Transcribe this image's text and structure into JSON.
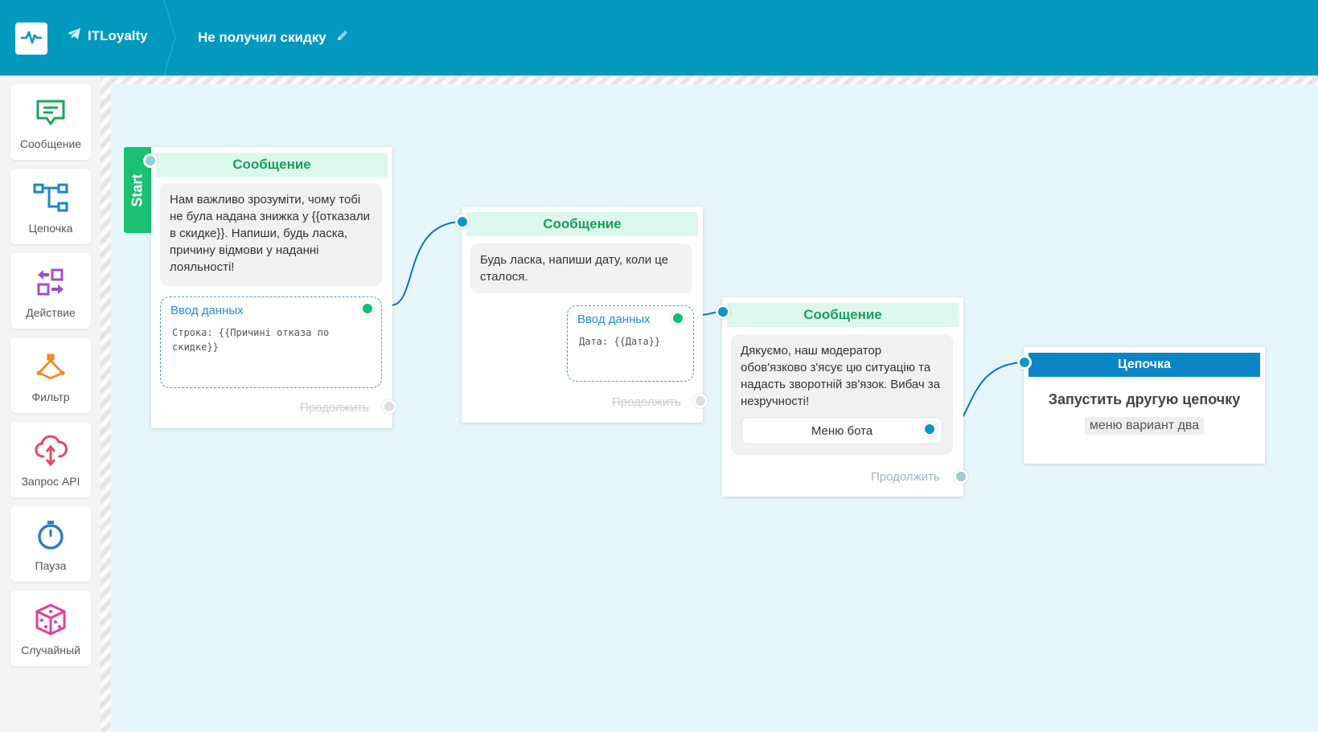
{
  "header": {
    "bot_name": "ITLoyalty",
    "chain_title": "Не получил скидку",
    "icons": {
      "logo": "pulse-icon",
      "bot": "telegram-icon",
      "edit": "pencil-icon"
    }
  },
  "sidebar": {
    "items": [
      {
        "label": "Сообщение",
        "icon": "message-icon",
        "color": "#1aa85a"
      },
      {
        "label": "Цепочка",
        "icon": "chain-icon",
        "color": "#1487c8"
      },
      {
        "label": "Действие",
        "icon": "action-icon",
        "color": "#a04fc9"
      },
      {
        "label": "Фильтр",
        "icon": "filter-icon",
        "color": "#f08a1c"
      },
      {
        "label": "Запрос API",
        "icon": "api-cloud-icon",
        "color": "#e14b66"
      },
      {
        "label": "Пауза",
        "icon": "timer-icon",
        "color": "#2f7fb8"
      },
      {
        "label": "Случайный",
        "icon": "dice-icon",
        "color": "#e0409a"
      }
    ]
  },
  "nodes": {
    "start_label": "Start",
    "node1": {
      "title": "Сообщение",
      "text": "Нам важливо зрозуміти, чому тобі не була надана знижка у {{отказали в  скидке}}. Напиши, будь ласка, причину відмови у наданні лояльності!",
      "input_title": "Ввод данных",
      "input_value": "Строка: {{Причині отказа по скидке}}",
      "continue": "Продолжить"
    },
    "node2": {
      "title": "Сообщение",
      "text": "Будь ласка, напиши дату, коли це сталося.",
      "input_title": "Ввод данных",
      "input_value": "Дата: {{Дата}}",
      "continue": "Продолжить"
    },
    "node3": {
      "title": "Сообщение",
      "text": "Дякуємо, наш модератор обов'язково з'ясує цю ситуацію та надасть зворотній зв'язок. Вибач за незручності!",
      "button": "Меню бота",
      "continue": "Продолжить"
    },
    "node4": {
      "title": "Цепочка",
      "subtitle": "Запустить другую цепочку",
      "chain_name": "меню вариант два"
    }
  },
  "colors": {
    "header": "#0399bf",
    "canvas": "#e6f7f9",
    "message_head": "#dcf8ee",
    "chain_head": "#0a86c6",
    "wire": "#1669d6"
  }
}
